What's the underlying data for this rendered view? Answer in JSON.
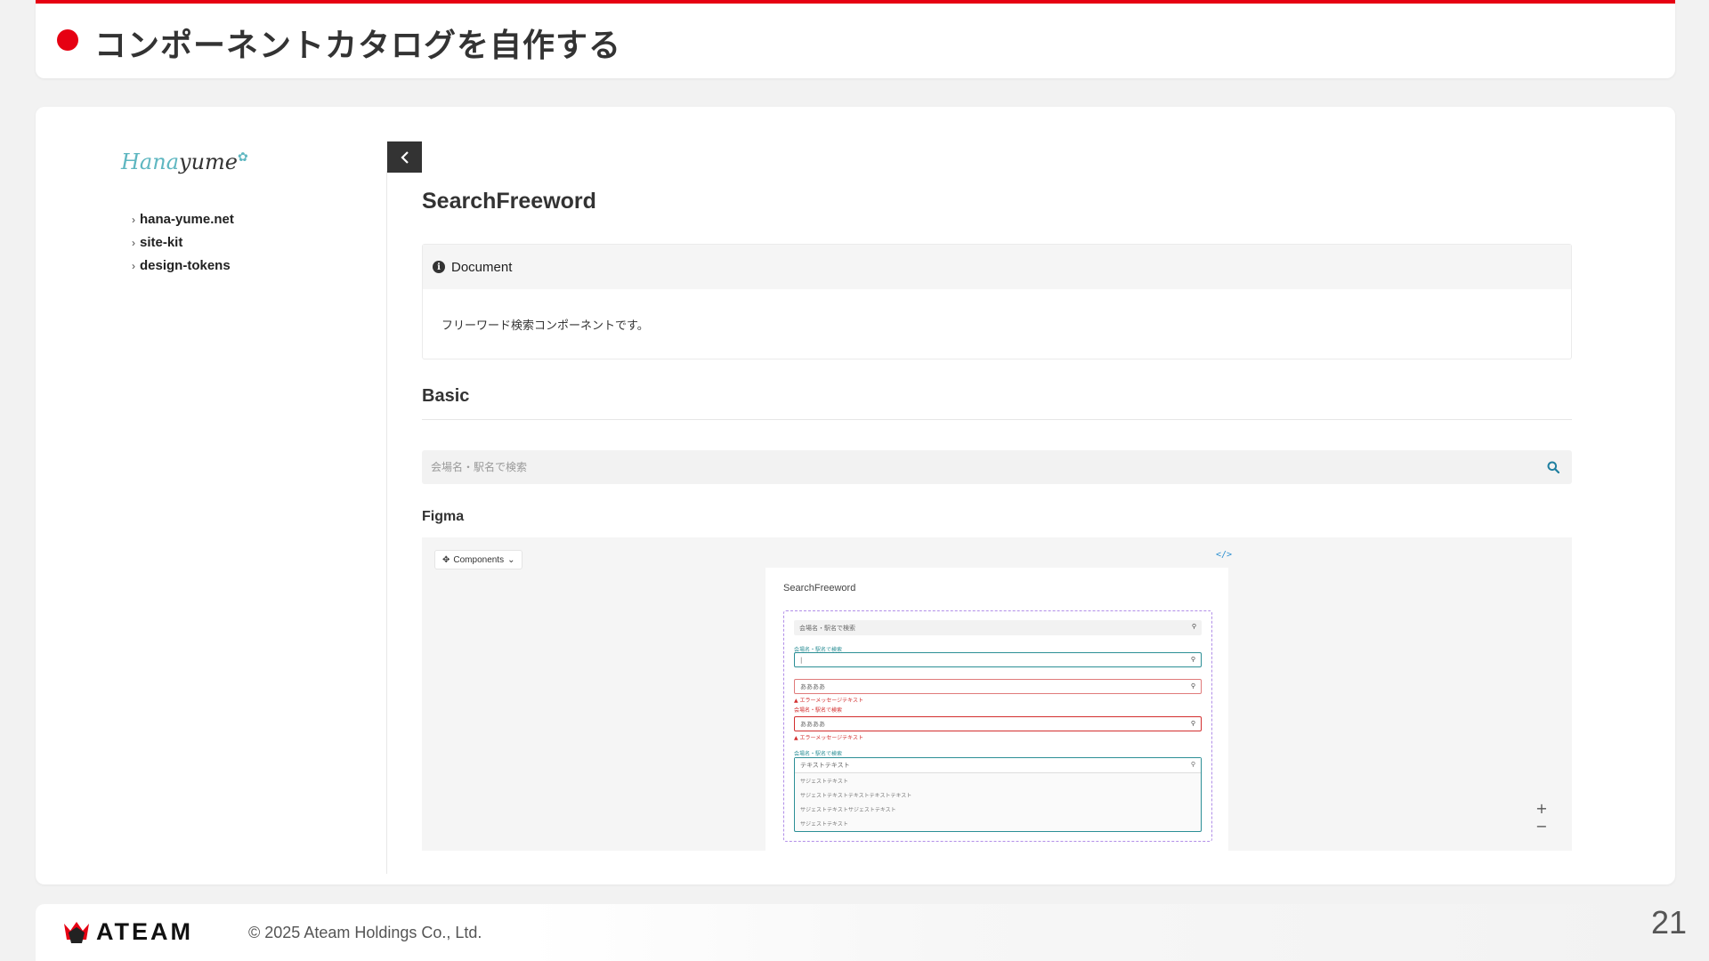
{
  "slide": {
    "title": "コンポーネントカタログを自作する",
    "page_number": "21",
    "accent_color": "#e60012"
  },
  "sidebar": {
    "logo": {
      "part1": "Hana",
      "part2": "yume",
      "mark": "✿"
    },
    "items": [
      {
        "label": "hana-yume.net"
      },
      {
        "label": "site-kit"
      },
      {
        "label": "design-tokens"
      }
    ]
  },
  "main": {
    "page_title": "SearchFreeword",
    "document": {
      "label": "Document",
      "text": "フリーワード検索コンポーネントです。"
    },
    "basic": {
      "title": "Basic",
      "search_placeholder": "会場名・駅名で検索"
    },
    "figma": {
      "title": "Figma",
      "components_button": "Components",
      "canvas_title": "SearchFreeword",
      "field_label": "会場名・駅名で検索",
      "field_values": {
        "placeholder": "会場名・駅名で検索",
        "caret": "|",
        "error_value": "ああああ",
        "error_message": "▲ エラーメッセージテキスト",
        "suggest_value": "テキストテキスト"
      },
      "suggestions": [
        "サジェストテキスト",
        "サジェストテキストテキストテキストテキスト",
        "サジェストテキストサジェストテキスト",
        "サジェストテキスト"
      ],
      "zoom_in": "+",
      "zoom_out": "−"
    }
  },
  "footer": {
    "brand": "ATEAM",
    "copyright": "© 2025 Ateam Holdings Co., Ltd."
  }
}
